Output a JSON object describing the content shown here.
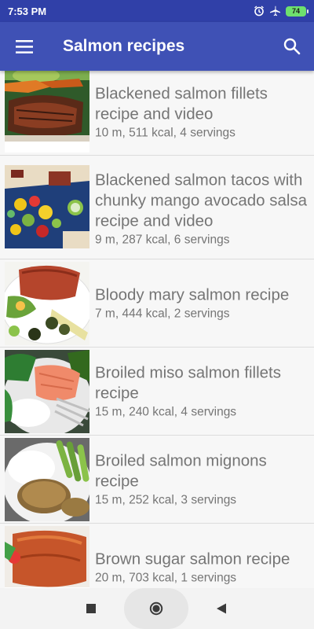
{
  "status_bar": {
    "time": "7:53 PM",
    "battery": "74",
    "icons": [
      "alarm-icon",
      "airplane-icon",
      "battery-icon"
    ]
  },
  "app_bar": {
    "title": "Salmon recipes",
    "menu_icon": "hamburger-menu-icon",
    "search_icon": "search-icon",
    "color": "#3f51b5"
  },
  "recipes": [
    {
      "title": "Blackened salmon fillets recipe and video",
      "meta": "10 m, 511 kcal, 4 servings"
    },
    {
      "title": "Blackened salmon tacos with chunky mango avocado salsa recipe and video",
      "meta": "9 m, 287 kcal, 6 servings"
    },
    {
      "title": "Bloody mary salmon recipe",
      "meta": "7 m, 444 kcal, 2 servings"
    },
    {
      "title": "Broiled miso salmon fillets recipe",
      "meta": "15 m, 240 kcal, 4 servings"
    },
    {
      "title": "Broiled salmon mignons recipe",
      "meta": "15 m, 252 kcal, 3 servings"
    },
    {
      "title": "Brown sugar salmon recipe",
      "meta": "20 m, 703 kcal, 1 servings"
    }
  ],
  "nav_bar": {
    "icons": [
      "recents-square-icon",
      "home-circle-icon",
      "back-triangle-icon"
    ]
  }
}
